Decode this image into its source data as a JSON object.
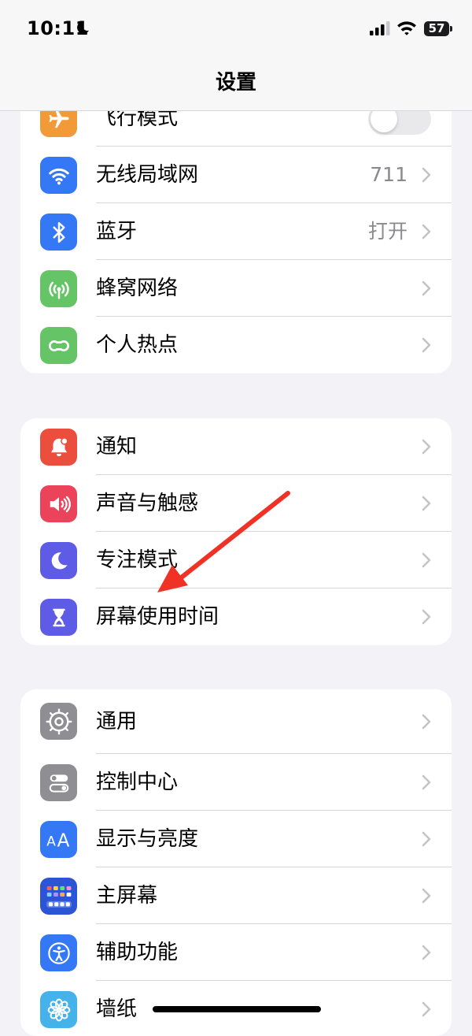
{
  "status": {
    "time": "10:11",
    "battery": "57"
  },
  "nav": {
    "title": "设置"
  },
  "group1": [
    {
      "label": "飞行模式",
      "toggle": "off"
    },
    {
      "label": "无线局域网",
      "value": "711"
    },
    {
      "label": "蓝牙",
      "value": "打开"
    },
    {
      "label": "蜂窝网络"
    },
    {
      "label": "个人热点"
    }
  ],
  "group2": [
    {
      "label": "通知"
    },
    {
      "label": "声音与触感"
    },
    {
      "label": "专注模式"
    },
    {
      "label": "屏幕使用时间"
    }
  ],
  "group3": [
    {
      "label": "通用"
    },
    {
      "label": "控制中心"
    },
    {
      "label": "显示与亮度"
    },
    {
      "label": "主屏幕"
    },
    {
      "label": "辅助功能"
    },
    {
      "label": "墙纸"
    }
  ],
  "icons": {
    "airplane": "#f19a37",
    "wifi": "#3478f6",
    "bluetooth": "#3478f6",
    "cellular": "#65c466",
    "hotspot": "#65c466",
    "notifications": "#eb4e3d",
    "sounds": "#eb445a",
    "focus": "#5e5ce6",
    "screen_time": "#5e5ce6",
    "general": "#8e8e93",
    "control_center": "#8e8e93",
    "display": "#3478f6",
    "home_screen": "#2c55d6",
    "accessibility": "#3478f6",
    "wallpaper": "#46b2ea"
  },
  "annotation": {
    "arrow_color": "#f03226"
  }
}
